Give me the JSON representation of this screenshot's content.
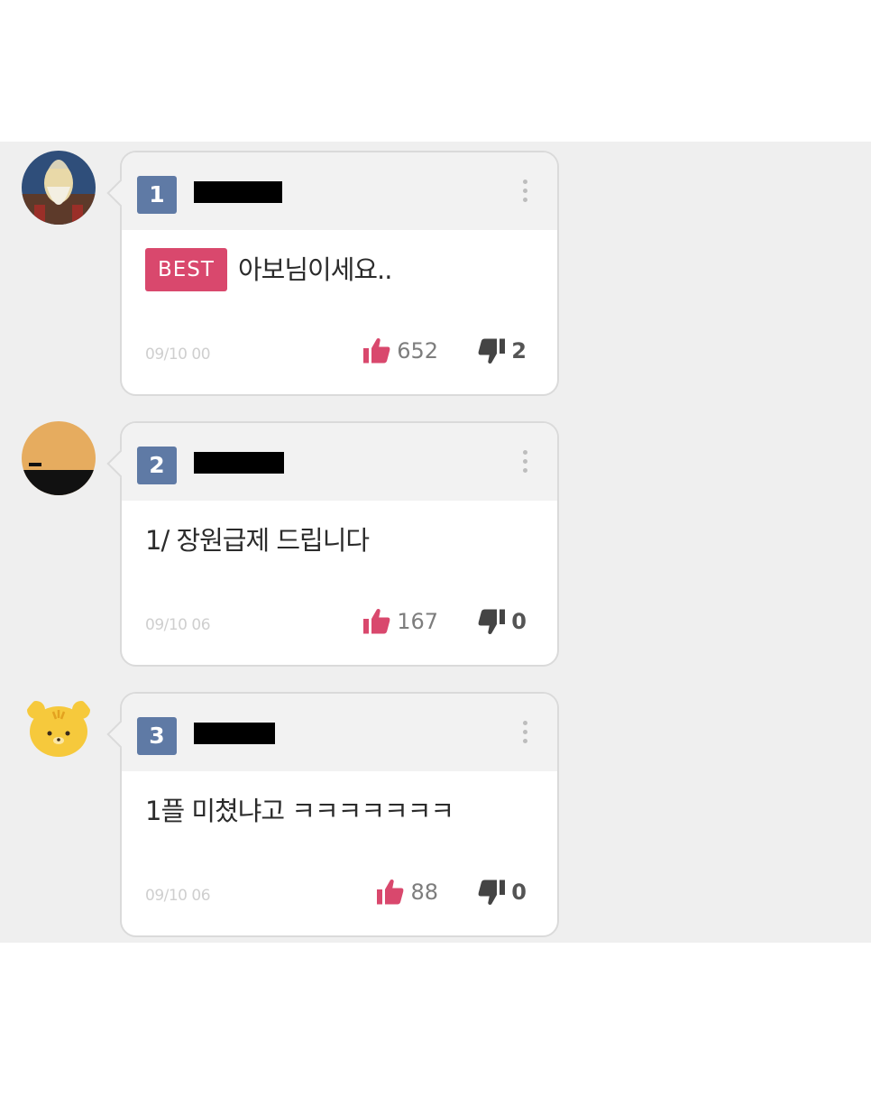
{
  "comments": [
    {
      "rank": "1",
      "best_label": "BEST",
      "text": "아보님이세요..",
      "date": "09/10 00",
      "likes": "652",
      "dislikes": "2",
      "avatar": "old-man-avatar"
    },
    {
      "rank": "2",
      "text": "1/ 장원급제 드립니다",
      "date": "09/10 06",
      "likes": "167",
      "dislikes": "0",
      "avatar": "landscape-avatar"
    },
    {
      "rank": "3",
      "text": "1플 미쳤냐고 ㅋㅋㅋㅋㅋㅋㅋ",
      "date": "09/10 06",
      "likes": "88",
      "dislikes": "0",
      "avatar": "yellow-bear-avatar"
    }
  ],
  "icons": {
    "like": "thumbs-up-icon",
    "dislike": "thumbs-down-icon",
    "menu": "more-vertical-icon"
  },
  "colors": {
    "rank_badge": "#5f7aa5",
    "best_badge": "#d9486d",
    "like_icon": "#d9486d",
    "dislike_icon": "#444444",
    "panel_bg": "#efefef"
  }
}
